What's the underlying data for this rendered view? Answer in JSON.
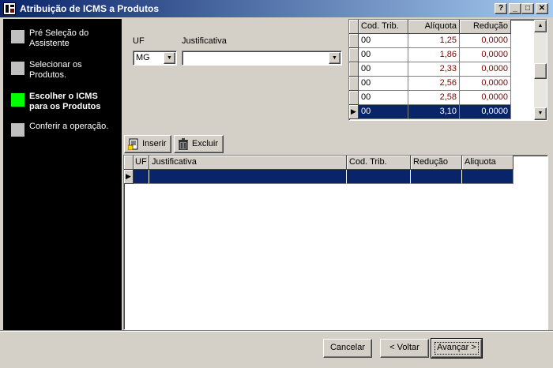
{
  "window": {
    "title": "Atribuição de ICMS a Produtos",
    "help_glyph": "?",
    "min_glyph": "_",
    "max_glyph": "□",
    "close_glyph": "✕"
  },
  "wizard_steps": [
    {
      "label": "Pré Seleção do Assistente",
      "active": false
    },
    {
      "label": "Selecionar os Produtos.",
      "active": false
    },
    {
      "label": "Escolher o ICMS para os Produtos",
      "active": true
    },
    {
      "label": "Conferir a operação.",
      "active": false
    }
  ],
  "filters": {
    "uf_label": "UF",
    "uf_value": "MG",
    "justificativa_label": "Justificativa",
    "justificativa_value": ""
  },
  "aliquota_grid": {
    "columns": [
      "Cod. Trib.",
      "Alíquota",
      "Redução"
    ],
    "rows": [
      {
        "cod": "00",
        "aliquota": "1,25",
        "reducao": "0,0000"
      },
      {
        "cod": "00",
        "aliquota": "1,86",
        "reducao": "0,0000"
      },
      {
        "cod": "00",
        "aliquota": "2,33",
        "reducao": "0,0000"
      },
      {
        "cod": "00",
        "aliquota": "2,56",
        "reducao": "0,0000"
      },
      {
        "cod": "00",
        "aliquota": "2,58",
        "reducao": "0,0000"
      },
      {
        "cod": "00",
        "aliquota": "3,10",
        "reducao": "0,0000"
      }
    ],
    "selected_row": 5
  },
  "toolbar": {
    "insert_label": "Inserir",
    "delete_label": "Excluir"
  },
  "lower_grid": {
    "columns": [
      "UF",
      "Justificativa",
      "Cod. Trib.",
      "Redução",
      "Aliquota"
    ]
  },
  "footer": {
    "cancel_label": "Cancelar",
    "back_label": "< Voltar",
    "next_label": "Avançar >"
  },
  "colors": {
    "title_gradient_start": "#0a246a",
    "title_gradient_end": "#a6caf0",
    "selection": "#0a246a",
    "active_step": "#00ff00",
    "number_text": "#800000"
  }
}
